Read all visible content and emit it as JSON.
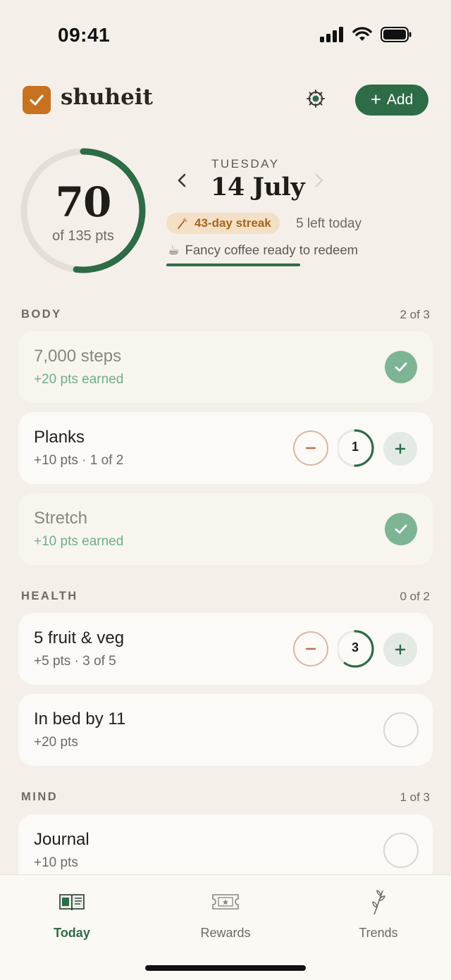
{
  "status_bar": {
    "time": "09:41"
  },
  "header": {
    "brand": "shuheit",
    "add_label": "Add"
  },
  "summary": {
    "score": "70",
    "score_sub": "of 135 pts",
    "progress_fraction": 0.5185,
    "day_name": "TUESDAY",
    "date": "14 July",
    "streak": "43-day streak",
    "left_today": "5 left today",
    "redeem_icon": "☕",
    "redeem_text": "Fancy coffee ready to redeem"
  },
  "colors": {
    "accent": "#2E6B47",
    "brand": "#C8711F",
    "done": "#7DB594",
    "background": "#F4F0E9"
  },
  "sections": {
    "body": {
      "title": "BODY",
      "count": "2 of 3",
      "items": [
        {
          "title": "7,000 steps",
          "sub": "+20 pts earned",
          "state": "done"
        },
        {
          "title": "Planks",
          "sub": "+10 pts · 1 of 2",
          "state": "stepper",
          "count": "1",
          "progress": 0.5
        },
        {
          "title": "Stretch",
          "sub": "+10 pts earned",
          "state": "done"
        }
      ]
    },
    "health": {
      "title": "HEALTH",
      "count": "0 of 2",
      "items": [
        {
          "title": "5 fruit & veg",
          "sub": "+5 pts · 3 of 5",
          "state": "stepper",
          "count": "3",
          "progress": 0.6
        },
        {
          "title": "In bed by 11",
          "sub": "+20 pts",
          "state": "todo"
        }
      ]
    },
    "mind": {
      "title": "MIND",
      "count": "1 of 3",
      "items": [
        {
          "title": "Journal",
          "sub": "+10 pts",
          "state": "todo"
        }
      ]
    }
  },
  "tabbar": {
    "tabs": [
      {
        "label": "Today",
        "icon": "book-icon",
        "active": true
      },
      {
        "label": "Rewards",
        "icon": "ticket-icon",
        "active": false
      },
      {
        "label": "Trends",
        "icon": "sprout-icon",
        "active": false
      }
    ]
  }
}
